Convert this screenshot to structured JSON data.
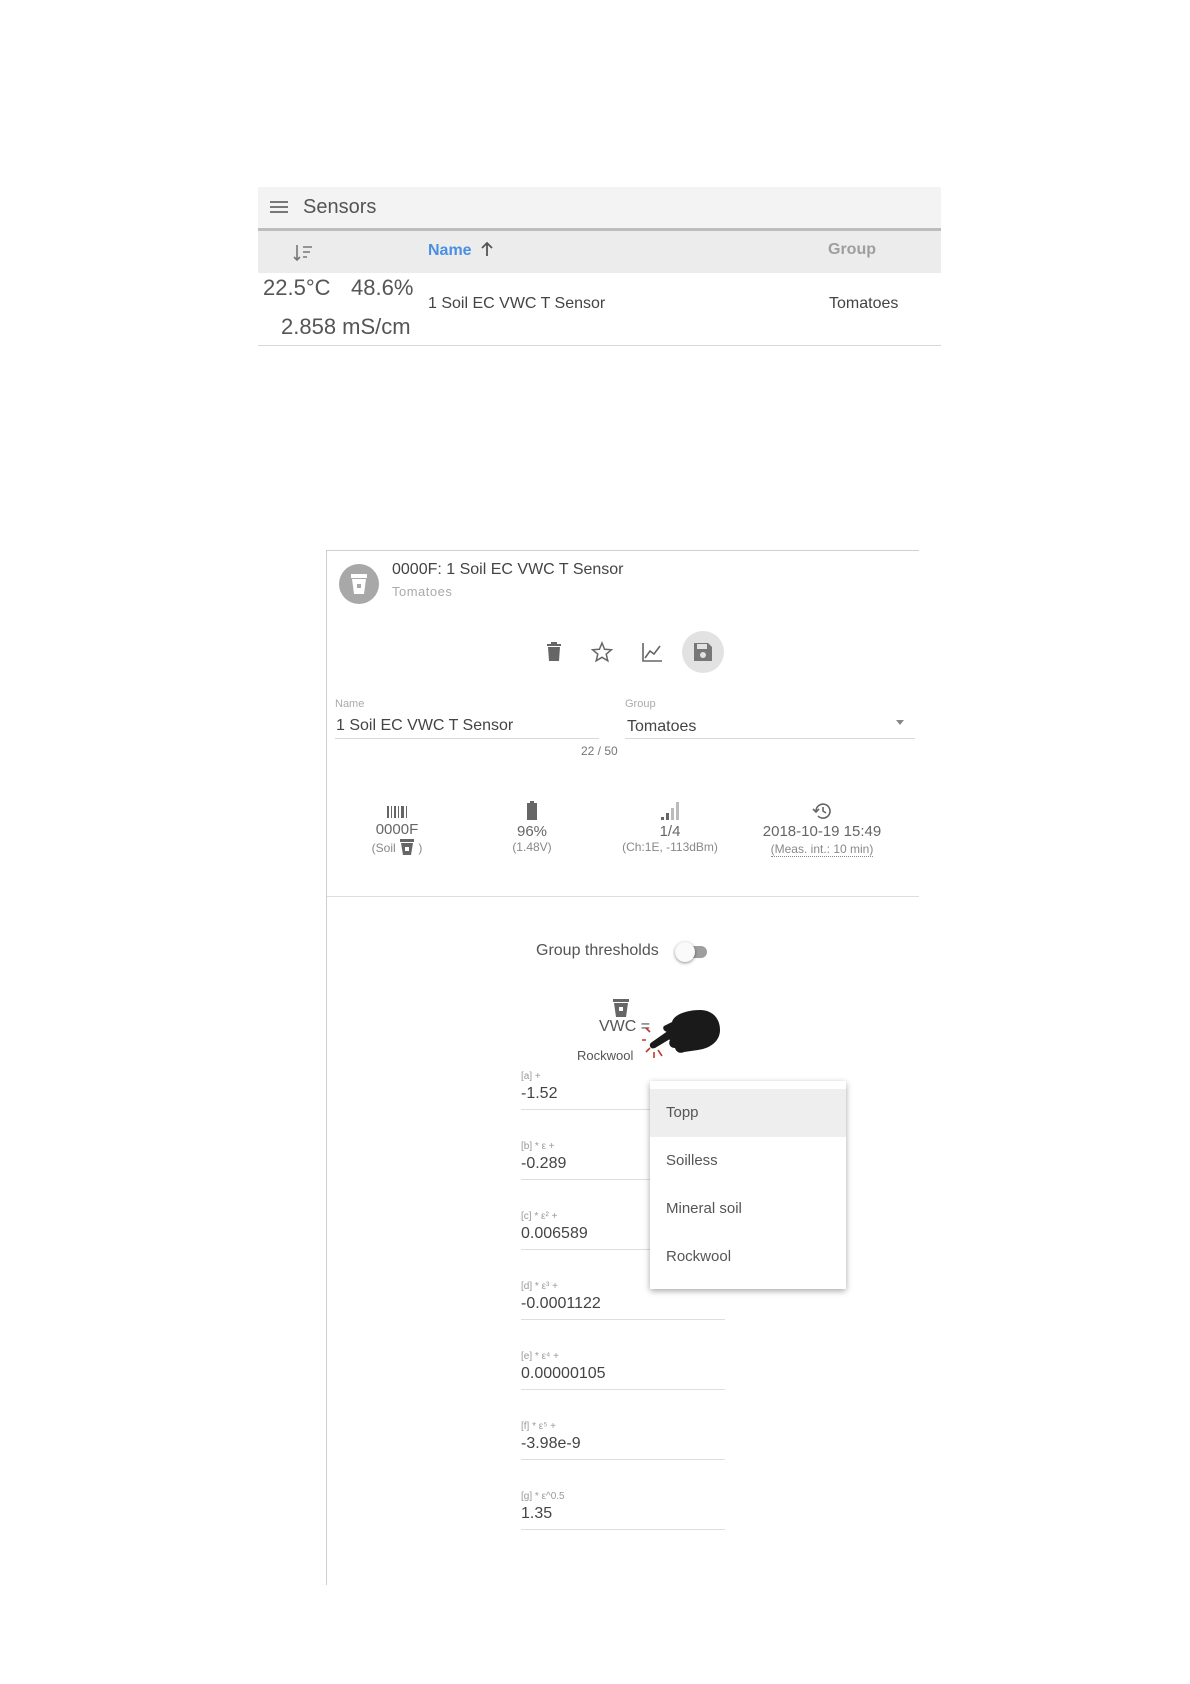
{
  "sensors_list": {
    "title": "Sensors",
    "columns": {
      "name": "Name",
      "group": "Group"
    },
    "rows": [
      {
        "temperature": "22.5°C",
        "humidity": "48.6%",
        "ec": "2.858 mS/cm",
        "name": "1 Soil EC VWC T Sensor",
        "group": "Tomatoes"
      }
    ]
  },
  "detail": {
    "title": "0000F: 1 Soil EC VWC T Sensor",
    "subtitle": "Tomatoes",
    "toolbar": [
      "trash-icon",
      "star-icon",
      "chart-icon",
      "save-icon"
    ],
    "name_field": {
      "label": "Name",
      "value": "1 Soil EC VWC T Sensor",
      "counter": "22 / 50"
    },
    "group_field": {
      "label": "Group",
      "value": "Tomatoes"
    },
    "info": {
      "id": {
        "value": "0000F",
        "type_prefix": "(Soil",
        "type_suffix": ")"
      },
      "battery": {
        "value": "96%",
        "sub": "(1.48V)"
      },
      "signal": {
        "value": "1/4",
        "sub": "(Ch:1E, -113dBm)"
      },
      "last_seen": {
        "value": "2018-10-19 15:49",
        "sub": "(Meas. int.: 10 min)"
      }
    },
    "group_thresholds": {
      "label": "Group thresholds",
      "enabled": false
    },
    "formula": {
      "lhs": "VWC =",
      "model": "Rockwool"
    },
    "coefficients": [
      {
        "label": "[a] +",
        "value": "-1.52"
      },
      {
        "label": "[b] * ε +",
        "value": "-0.289"
      },
      {
        "label": "[c] * ε² +",
        "value": "0.006589"
      },
      {
        "label": "[d] * ε³ +",
        "value": "-0.0001122"
      },
      {
        "label": "[e] * ε⁴ +",
        "value": "0.00000105"
      },
      {
        "label": "[f] * ε⁵ +",
        "value": "-3.98e-9"
      },
      {
        "label": "[g] * ε^0.5",
        "value": "1.35"
      }
    ],
    "model_options": [
      "Topp",
      "Soilless",
      "Mineral soil",
      "Rockwool"
    ],
    "model_selected_index": 0
  }
}
